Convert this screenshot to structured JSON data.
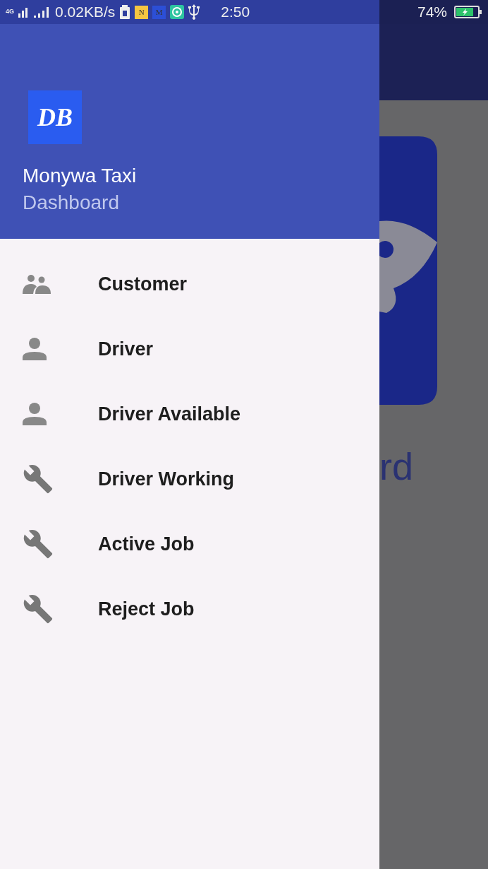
{
  "status_bar": {
    "network": "4G",
    "speed": "0.02KB/s",
    "notifications": [
      {
        "kind": "clipboard"
      },
      {
        "kind": "letter",
        "text": "N",
        "color": "#f5c542"
      },
      {
        "kind": "letter",
        "text": "M",
        "color": "#2c4fd6"
      },
      {
        "kind": "target",
        "color": "#2ec4a0"
      },
      {
        "kind": "usb"
      }
    ],
    "time": "2:50",
    "battery": "74%"
  },
  "background": {
    "label": "rd"
  },
  "drawer": {
    "logo": "DB",
    "title": "Monywa Taxi",
    "subtitle": "Dashboard",
    "items": [
      {
        "label": "Customer",
        "kind": "people"
      },
      {
        "label": "Driver",
        "kind": "person"
      },
      {
        "label": "Driver Available",
        "kind": "person"
      },
      {
        "label": "Driver Working",
        "kind": "wrench"
      },
      {
        "label": "Active Job",
        "kind": "wrench"
      },
      {
        "label": "Reject Job",
        "kind": "wrench"
      }
    ]
  }
}
